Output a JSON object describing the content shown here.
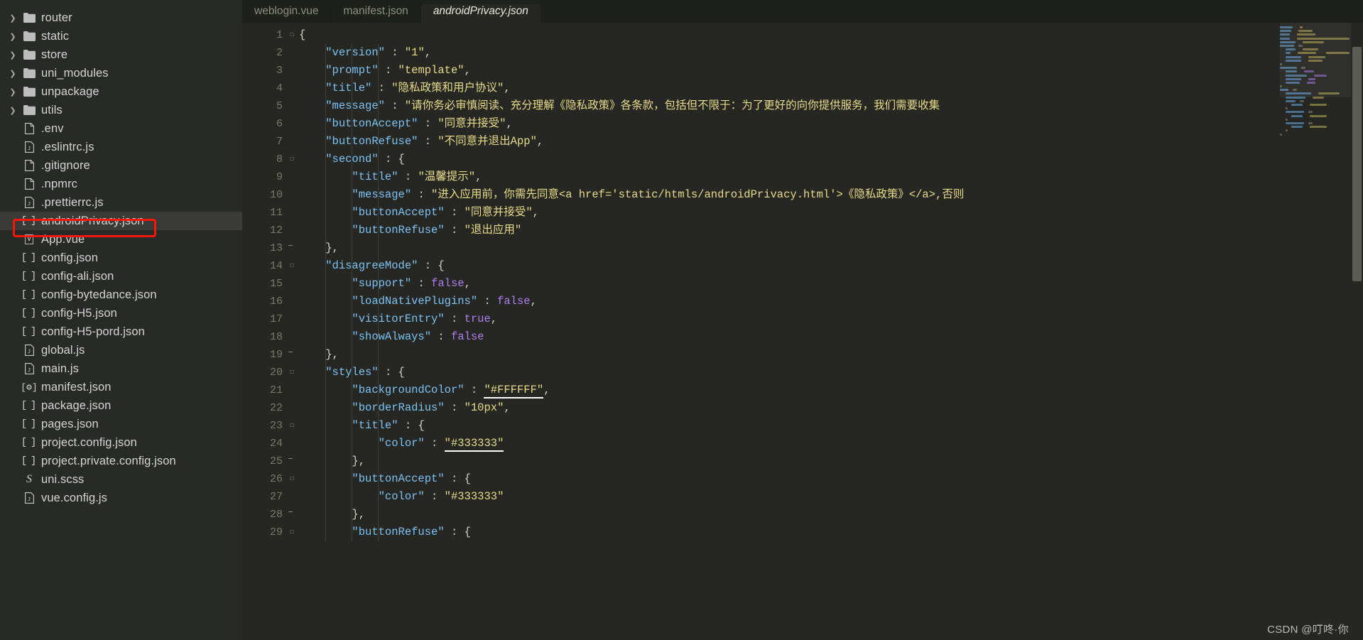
{
  "app": {
    "watermark": "CSDN @叮咚·你"
  },
  "sidebar": {
    "items": [
      {
        "label": "router",
        "kind": "folder",
        "expandable": true
      },
      {
        "label": "static",
        "kind": "folder",
        "expandable": true
      },
      {
        "label": "store",
        "kind": "folder",
        "expandable": true
      },
      {
        "label": "uni_modules",
        "kind": "folder",
        "expandable": true
      },
      {
        "label": "unpackage",
        "kind": "folder",
        "expandable": true
      },
      {
        "label": "utils",
        "kind": "folder",
        "expandable": true
      },
      {
        "label": ".env",
        "kind": "file",
        "expandable": false
      },
      {
        "label": ".eslintrc.js",
        "kind": "js",
        "expandable": false
      },
      {
        "label": ".gitignore",
        "kind": "file",
        "expandable": false
      },
      {
        "label": ".npmrc",
        "kind": "file",
        "expandable": false
      },
      {
        "label": ".prettierrc.js",
        "kind": "js",
        "expandable": false
      },
      {
        "label": "androidPrivacy.json",
        "kind": "json",
        "expandable": false,
        "selected": true
      },
      {
        "label": "App.vue",
        "kind": "vue",
        "expandable": false
      },
      {
        "label": "config.json",
        "kind": "json",
        "expandable": false
      },
      {
        "label": "config-ali.json",
        "kind": "json",
        "expandable": false
      },
      {
        "label": "config-bytedance.json",
        "kind": "json",
        "expandable": false
      },
      {
        "label": "config-H5.json",
        "kind": "json",
        "expandable": false
      },
      {
        "label": "config-H5-pord.json",
        "kind": "json",
        "expandable": false
      },
      {
        "label": "global.js",
        "kind": "js",
        "expandable": false
      },
      {
        "label": "main.js",
        "kind": "js",
        "expandable": false
      },
      {
        "label": "manifest.json",
        "kind": "manifest",
        "expandable": false
      },
      {
        "label": "package.json",
        "kind": "json",
        "expandable": false
      },
      {
        "label": "pages.json",
        "kind": "json",
        "expandable": false
      },
      {
        "label": "project.config.json",
        "kind": "json",
        "expandable": false
      },
      {
        "label": "project.private.config.json",
        "kind": "json",
        "expandable": false
      },
      {
        "label": "uni.scss",
        "kind": "scss",
        "expandable": false
      },
      {
        "label": "vue.config.js",
        "kind": "js",
        "expandable": false
      }
    ],
    "highlight_target": "androidPrivacy.json",
    "highlight_color": "#fb1605"
  },
  "tabs": [
    {
      "label": "weblogin.vue",
      "active": false
    },
    {
      "label": "manifest.json",
      "active": false
    },
    {
      "label": "androidPrivacy.json",
      "active": true
    }
  ],
  "editor": {
    "file": "androidPrivacy.json",
    "language": "json",
    "theme_colors": {
      "background": "#262722",
      "key": "#7cc2f5",
      "string": "#e7db8a",
      "boolean": "#b07ef0",
      "punctuation": "#d2d2cb",
      "line_number": "#777a72"
    },
    "lines": [
      {
        "n": 1,
        "fold": "open",
        "tokens": [
          {
            "t": "{",
            "c": "p"
          }
        ]
      },
      {
        "n": 2,
        "fold": "",
        "tokens": [
          {
            "t": "    ",
            "c": "p"
          },
          {
            "t": "\"version\"",
            "c": "k"
          },
          {
            "t": " : ",
            "c": "p"
          },
          {
            "t": "\"1\"",
            "c": "s"
          },
          {
            "t": ",",
            "c": "p"
          }
        ]
      },
      {
        "n": 3,
        "fold": "",
        "tokens": [
          {
            "t": "    ",
            "c": "p"
          },
          {
            "t": "\"prompt\"",
            "c": "k"
          },
          {
            "t": " : ",
            "c": "p"
          },
          {
            "t": "\"template\"",
            "c": "s"
          },
          {
            "t": ",",
            "c": "p"
          }
        ]
      },
      {
        "n": 4,
        "fold": "",
        "tokens": [
          {
            "t": "    ",
            "c": "p"
          },
          {
            "t": "\"title\"",
            "c": "k"
          },
          {
            "t": " : ",
            "c": "p"
          },
          {
            "t": "\"隐私政策和用户协议\"",
            "c": "s"
          },
          {
            "t": ",",
            "c": "p"
          }
        ]
      },
      {
        "n": 5,
        "fold": "",
        "tokens": [
          {
            "t": "    ",
            "c": "p"
          },
          {
            "t": "\"message\"",
            "c": "k"
          },
          {
            "t": " : ",
            "c": "p"
          },
          {
            "t": "\"请你务必审慎阅读、充分理解《隐私政策》各条款，包括但不限于：为了更好的向你提供服务，我们需要收集",
            "c": "s"
          }
        ]
      },
      {
        "n": 6,
        "fold": "",
        "tokens": [
          {
            "t": "    ",
            "c": "p"
          },
          {
            "t": "\"buttonAccept\"",
            "c": "k"
          },
          {
            "t": " : ",
            "c": "p"
          },
          {
            "t": "\"同意并接受\"",
            "c": "s"
          },
          {
            "t": ",",
            "c": "p"
          }
        ]
      },
      {
        "n": 7,
        "fold": "",
        "tokens": [
          {
            "t": "    ",
            "c": "p"
          },
          {
            "t": "\"buttonRefuse\"",
            "c": "k"
          },
          {
            "t": " : ",
            "c": "p"
          },
          {
            "t": "\"不同意并退出App\"",
            "c": "s"
          },
          {
            "t": ",",
            "c": "p"
          }
        ]
      },
      {
        "n": 8,
        "fold": "open",
        "tokens": [
          {
            "t": "    ",
            "c": "p"
          },
          {
            "t": "\"second\"",
            "c": "k"
          },
          {
            "t": " : ",
            "c": "p"
          },
          {
            "t": "{",
            "c": "p"
          }
        ]
      },
      {
        "n": 9,
        "fold": "",
        "tokens": [
          {
            "t": "        ",
            "c": "p"
          },
          {
            "t": "\"title\"",
            "c": "k"
          },
          {
            "t": " : ",
            "c": "p"
          },
          {
            "t": "\"温馨提示\"",
            "c": "s"
          },
          {
            "t": ",",
            "c": "p"
          }
        ]
      },
      {
        "n": 10,
        "fold": "",
        "tokens": [
          {
            "t": "        ",
            "c": "p"
          },
          {
            "t": "\"message\"",
            "c": "k"
          },
          {
            "t": " : ",
            "c": "p"
          },
          {
            "t": "\"进入应用前，你需先同意<a href='static/htmls/androidPrivacy.html'>《隐私政策》</a>,否则",
            "c": "s"
          }
        ]
      },
      {
        "n": 11,
        "fold": "",
        "tokens": [
          {
            "t": "        ",
            "c": "p"
          },
          {
            "t": "\"buttonAccept\"",
            "c": "k"
          },
          {
            "t": " : ",
            "c": "p"
          },
          {
            "t": "\"同意并接受\"",
            "c": "s"
          },
          {
            "t": ",",
            "c": "p"
          }
        ]
      },
      {
        "n": 12,
        "fold": "",
        "tokens": [
          {
            "t": "        ",
            "c": "p"
          },
          {
            "t": "\"buttonRefuse\"",
            "c": "k"
          },
          {
            "t": " : ",
            "c": "p"
          },
          {
            "t": "\"退出应用\"",
            "c": "s"
          }
        ]
      },
      {
        "n": 13,
        "fold": "bar",
        "tokens": [
          {
            "t": "    },",
            "c": "p"
          }
        ]
      },
      {
        "n": 14,
        "fold": "open",
        "tokens": [
          {
            "t": "    ",
            "c": "p"
          },
          {
            "t": "\"disagreeMode\"",
            "c": "k"
          },
          {
            "t": " : ",
            "c": "p"
          },
          {
            "t": "{",
            "c": "p"
          }
        ]
      },
      {
        "n": 15,
        "fold": "",
        "tokens": [
          {
            "t": "        ",
            "c": "p"
          },
          {
            "t": "\"support\"",
            "c": "k"
          },
          {
            "t": " : ",
            "c": "p"
          },
          {
            "t": "false",
            "c": "b"
          },
          {
            "t": ",",
            "c": "p"
          }
        ]
      },
      {
        "n": 16,
        "fold": "",
        "tokens": [
          {
            "t": "        ",
            "c": "p"
          },
          {
            "t": "\"loadNativePlugins\"",
            "c": "k"
          },
          {
            "t": " : ",
            "c": "p"
          },
          {
            "t": "false",
            "c": "b"
          },
          {
            "t": ",",
            "c": "p"
          }
        ]
      },
      {
        "n": 17,
        "fold": "",
        "tokens": [
          {
            "t": "        ",
            "c": "p"
          },
          {
            "t": "\"visitorEntry\"",
            "c": "k"
          },
          {
            "t": " : ",
            "c": "p"
          },
          {
            "t": "true",
            "c": "b"
          },
          {
            "t": ",",
            "c": "p"
          }
        ]
      },
      {
        "n": 18,
        "fold": "",
        "tokens": [
          {
            "t": "        ",
            "c": "p"
          },
          {
            "t": "\"showAlways\"",
            "c": "k"
          },
          {
            "t": " : ",
            "c": "p"
          },
          {
            "t": "false",
            "c": "b"
          }
        ]
      },
      {
        "n": 19,
        "fold": "bar",
        "tokens": [
          {
            "t": "    },",
            "c": "p"
          }
        ]
      },
      {
        "n": 20,
        "fold": "open",
        "tokens": [
          {
            "t": "    ",
            "c": "p"
          },
          {
            "t": "\"styles\"",
            "c": "k"
          },
          {
            "t": " : ",
            "c": "p"
          },
          {
            "t": "{",
            "c": "p"
          }
        ]
      },
      {
        "n": 21,
        "fold": "",
        "tokens": [
          {
            "t": "        ",
            "c": "p"
          },
          {
            "t": "\"backgroundColor\"",
            "c": "k"
          },
          {
            "t": " : ",
            "c": "p"
          },
          {
            "t": "\"#FFFFFF\"",
            "c": "s colordec"
          },
          {
            "t": ",",
            "c": "p"
          }
        ]
      },
      {
        "n": 22,
        "fold": "",
        "tokens": [
          {
            "t": "        ",
            "c": "p"
          },
          {
            "t": "\"borderRadius\"",
            "c": "k"
          },
          {
            "t": " : ",
            "c": "p"
          },
          {
            "t": "\"10px\"",
            "c": "s"
          },
          {
            "t": ",",
            "c": "p"
          }
        ]
      },
      {
        "n": 23,
        "fold": "open",
        "tokens": [
          {
            "t": "        ",
            "c": "p"
          },
          {
            "t": "\"title\"",
            "c": "k"
          },
          {
            "t": " : ",
            "c": "p"
          },
          {
            "t": "{",
            "c": "p"
          }
        ]
      },
      {
        "n": 24,
        "fold": "",
        "tokens": [
          {
            "t": "            ",
            "c": "p"
          },
          {
            "t": "\"color\"",
            "c": "k"
          },
          {
            "t": " : ",
            "c": "p"
          },
          {
            "t": "\"#333333\"",
            "c": "s colordec"
          }
        ]
      },
      {
        "n": 25,
        "fold": "bar",
        "tokens": [
          {
            "t": "        },",
            "c": "p"
          }
        ]
      },
      {
        "n": 26,
        "fold": "open",
        "tokens": [
          {
            "t": "        ",
            "c": "p"
          },
          {
            "t": "\"buttonAccept\"",
            "c": "k"
          },
          {
            "t": " : ",
            "c": "p"
          },
          {
            "t": "{",
            "c": "p"
          }
        ]
      },
      {
        "n": 27,
        "fold": "",
        "tokens": [
          {
            "t": "            ",
            "c": "p"
          },
          {
            "t": "\"color\"",
            "c": "k"
          },
          {
            "t": " : ",
            "c": "p"
          },
          {
            "t": "\"#333333\"",
            "c": "s"
          }
        ]
      },
      {
        "n": 28,
        "fold": "bar",
        "tokens": [
          {
            "t": "        },",
            "c": "p"
          }
        ]
      },
      {
        "n": 29,
        "fold": "open",
        "tokens": [
          {
            "t": "        ",
            "c": "p"
          },
          {
            "t": "\"buttonRefuse\"",
            "c": "k"
          },
          {
            "t": " : ",
            "c": "p"
          },
          {
            "t": "{",
            "c": "p"
          }
        ]
      }
    ]
  },
  "minimap": {
    "visible": true,
    "rows": [
      [
        [
          0,
          18,
          "k"
        ],
        [
          2,
          4,
          "s"
        ]
      ],
      [
        [
          0,
          16,
          "k"
        ],
        [
          2,
          20,
          "s"
        ]
      ],
      [
        [
          0,
          14,
          "k"
        ],
        [
          2,
          26,
          "s"
        ]
      ],
      [
        [
          0,
          18,
          "k"
        ],
        [
          2,
          260,
          "s"
        ]
      ],
      [
        [
          0,
          22,
          "k"
        ],
        [
          2,
          30,
          "s"
        ]
      ],
      [
        [
          0,
          20,
          "k"
        ],
        [
          1,
          6,
          "p"
        ]
      ],
      [
        [
          2,
          14,
          "k"
        ],
        [
          2,
          22,
          "s"
        ]
      ],
      [
        [
          2,
          20,
          "k"
        ],
        [
          2,
          70,
          "s"
        ],
        [
          3,
          150,
          "s"
        ]
      ],
      [
        [
          2,
          22,
          "k"
        ],
        [
          2,
          24,
          "s"
        ]
      ],
      [
        [
          2,
          22,
          "k"
        ],
        [
          2,
          20,
          "s"
        ]
      ],
      [
        [
          0,
          3,
          "p"
        ]
      ],
      [
        [
          0,
          24,
          "k"
        ],
        [
          1,
          6,
          "p"
        ]
      ],
      [
        [
          2,
          16,
          "k"
        ],
        [
          2,
          14,
          "b"
        ]
      ],
      [
        [
          2,
          30,
          "k"
        ],
        [
          2,
          18,
          "b"
        ]
      ],
      [
        [
          2,
          22,
          "k"
        ],
        [
          2,
          10,
          "b"
        ]
      ],
      [
        [
          2,
          20,
          "k"
        ],
        [
          2,
          12,
          "b"
        ]
      ],
      [
        [
          0,
          3,
          "p"
        ]
      ],
      [
        [
          0,
          12,
          "k"
        ],
        [
          1,
          6,
          "p"
        ]
      ],
      [
        [
          2,
          36,
          "k"
        ],
        [
          2,
          30,
          "s"
        ]
      ],
      [
        [
          2,
          28,
          "k"
        ],
        [
          2,
          16,
          "s"
        ]
      ],
      [
        [
          2,
          14,
          "k"
        ],
        [
          1,
          6,
          "p"
        ]
      ],
      [
        [
          4,
          16,
          "k"
        ],
        [
          2,
          24,
          "s"
        ]
      ],
      [
        [
          2,
          3,
          "p"
        ]
      ],
      [
        [
          2,
          26,
          "k"
        ],
        [
          1,
          6,
          "p"
        ]
      ],
      [
        [
          4,
          16,
          "k"
        ],
        [
          2,
          24,
          "s"
        ]
      ],
      [
        [
          2,
          3,
          "p"
        ]
      ],
      [
        [
          2,
          26,
          "k"
        ],
        [
          1,
          6,
          "p"
        ]
      ],
      [
        [
          4,
          16,
          "k"
        ],
        [
          2,
          24,
          "s"
        ]
      ],
      [
        [
          2,
          3,
          "p"
        ]
      ],
      [
        [
          0,
          3,
          "p"
        ]
      ]
    ]
  }
}
